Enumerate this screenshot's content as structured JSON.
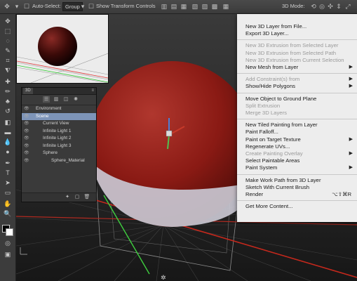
{
  "options_bar": {
    "auto_select_label": "Auto-Select:",
    "auto_select_value": "Group",
    "show_transform_label": "Show Transform Controls",
    "mode_label": "3D Mode:"
  },
  "panel3d": {
    "tab_label": "3D",
    "items": [
      {
        "label": "Environment",
        "indent": 10,
        "selected": false
      },
      {
        "label": "Scene",
        "indent": 10,
        "selected": true
      },
      {
        "label": "Current View",
        "indent": 20,
        "selected": false
      },
      {
        "label": "Infinite Light 1",
        "indent": 20,
        "selected": false
      },
      {
        "label": "Infinite Light 2",
        "indent": 20,
        "selected": false
      },
      {
        "label": "Infinite Light 3",
        "indent": 20,
        "selected": false
      },
      {
        "label": "Sphere",
        "indent": 20,
        "selected": false
      },
      {
        "label": "Sphere_Material",
        "indent": 32,
        "selected": false
      }
    ]
  },
  "menu": {
    "title": "3D",
    "items": [
      {
        "label": "New 3D Layer from File...",
        "enabled": true
      },
      {
        "label": "Export 3D Layer...",
        "enabled": true
      },
      {
        "separator": true
      },
      {
        "label": "New 3D Extrusion from Selected Layer",
        "enabled": false
      },
      {
        "label": "New 3D Extrusion from Selected Path",
        "enabled": false
      },
      {
        "label": "New 3D Extrusion from Current Selection",
        "enabled": false
      },
      {
        "label": "New Mesh from Layer",
        "enabled": true,
        "submenu": true
      },
      {
        "separator": true
      },
      {
        "label": "Add Constraint(s) from",
        "enabled": false,
        "submenu": true
      },
      {
        "label": "Show/Hide Polygons",
        "enabled": true,
        "submenu": true
      },
      {
        "separator": true
      },
      {
        "label": "Move Object to Ground Plane",
        "enabled": true
      },
      {
        "label": "Split Extrusion",
        "enabled": false
      },
      {
        "label": "Merge 3D Layers",
        "enabled": false
      },
      {
        "separator": true
      },
      {
        "label": "New Tiled Painting from Layer",
        "enabled": true
      },
      {
        "label": "Paint Falloff...",
        "enabled": true
      },
      {
        "label": "Paint on Target Texture",
        "enabled": true,
        "submenu": true
      },
      {
        "label": "Regenerate UVs...",
        "enabled": true
      },
      {
        "label": "Create Painting Overlay",
        "enabled": false,
        "submenu": true
      },
      {
        "label": "Select Paintable Areas",
        "enabled": true
      },
      {
        "label": "Paint System",
        "enabled": true,
        "submenu": true
      },
      {
        "separator": true
      },
      {
        "label": "Make Work Path from 3D Layer",
        "enabled": true
      },
      {
        "label": "Sketch With Current Brush",
        "enabled": true
      },
      {
        "label": "Render",
        "enabled": true,
        "shortcut": "⌥⇧⌘R"
      },
      {
        "separator": true
      },
      {
        "label": "Get More Content...",
        "enabled": true
      }
    ]
  },
  "colors": {
    "sphere": "#8a1a14",
    "menu_bg": "#ededed",
    "menu_title": "#3d6fd8",
    "selected_row": "#7d94b8"
  }
}
